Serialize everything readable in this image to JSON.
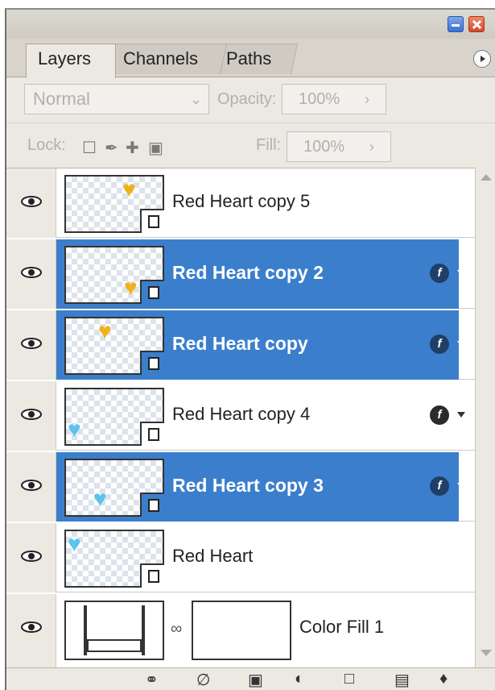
{
  "tabs": [
    "Layers",
    "Channels",
    "Paths"
  ],
  "blend_mode": "Normal",
  "opacity_label": "Opacity:",
  "opacity_value": "100%",
  "lock_label": "Lock:",
  "fill_label": "Fill:",
  "fill_value": "100%",
  "layers": [
    {
      "name": "Red Heart copy 5",
      "selected": false,
      "heart": "gold",
      "fx": false
    },
    {
      "name": "Red Heart copy 2",
      "selected": true,
      "heart": "gold",
      "fx": true
    },
    {
      "name": "Red Heart copy",
      "selected": true,
      "heart": "gold",
      "fx": true
    },
    {
      "name": "Red Heart copy 4",
      "selected": false,
      "heart": "blue",
      "fx": true
    },
    {
      "name": "Red Heart copy 3",
      "selected": true,
      "heart": "blue",
      "fx": true
    },
    {
      "name": "Red Heart",
      "selected": false,
      "heart": "blue",
      "fx": false
    },
    {
      "name": "Color Fill 1",
      "selected": false,
      "heart": null,
      "fx": false
    }
  ],
  "colors": {
    "selection": "#3b7fcc",
    "gold_heart": "#f0b21c",
    "blue_heart": "#5cc4ea"
  },
  "icons": [
    "eye-icon",
    "link-layers-icon",
    "fx-icon",
    "mask-icon",
    "adjustment-icon",
    "folder-icon",
    "new-layer-icon",
    "trash-icon"
  ]
}
